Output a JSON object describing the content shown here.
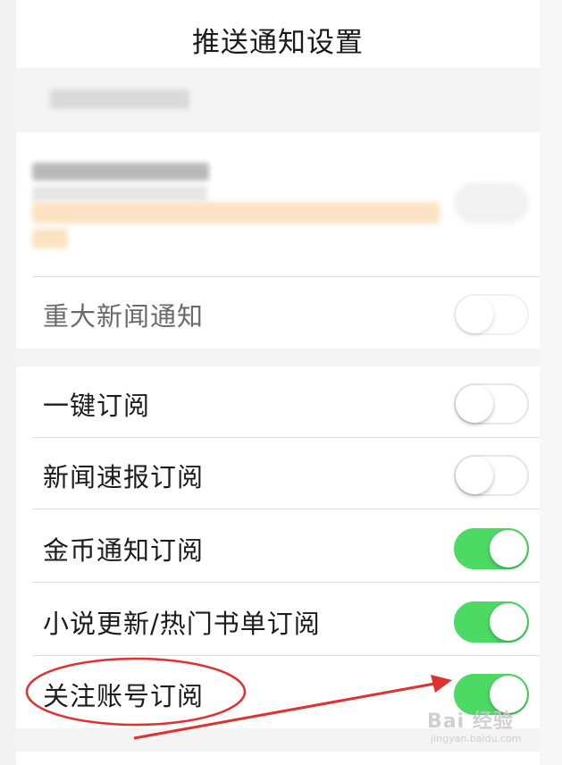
{
  "nav": {
    "title": "推送通知设置"
  },
  "settings": [
    {
      "label": "重大新闻通知",
      "on": false,
      "muted": true
    },
    {
      "label": "一键订阅",
      "on": false,
      "muted": false
    },
    {
      "label": "新闻速报订阅",
      "on": false,
      "muted": false
    },
    {
      "label": "金币通知订阅",
      "on": true,
      "muted": false
    },
    {
      "label": "小说更新/热门书单订阅",
      "on": true,
      "muted": false
    },
    {
      "label": "关注账号订阅",
      "on": true,
      "muted": false
    }
  ],
  "colors": {
    "toggle_on": "#4cd964",
    "annotation": "#e03030"
  },
  "watermark": {
    "main": "Bai 经验",
    "sub": "jingyan.baidu.com"
  }
}
